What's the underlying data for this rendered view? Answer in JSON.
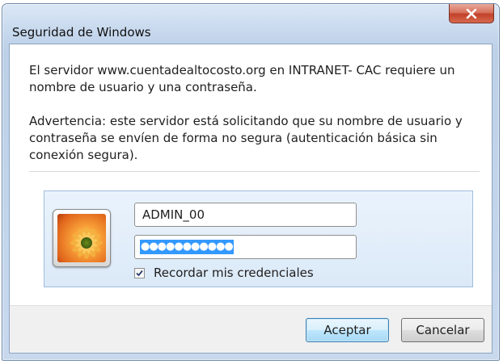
{
  "window": {
    "title": "Seguridad de Windows"
  },
  "message": {
    "line1": "El servidor www.cuentadealtocosto.org en INTRANET- CAC requiere un nombre de usuario y una contraseña.",
    "line2": "Advertencia: este servidor está solicitando que su nombre de usuario y contraseña se envíen de forma no segura (autenticación básica sin conexión segura)."
  },
  "credentials": {
    "username": "ADMIN_00",
    "password_mask": "●●●●●●●●●●●",
    "remember_label": "Recordar mis credenciales",
    "remember_checked": true
  },
  "buttons": {
    "accept": "Aceptar",
    "cancel": "Cancelar"
  },
  "icons": {
    "close": "close-icon",
    "avatar": "user-tile-flower",
    "check": "check-icon"
  },
  "colors": {
    "selection": "#3399ff",
    "close_button": "#c2402a",
    "panel": "#dbe9f8"
  }
}
